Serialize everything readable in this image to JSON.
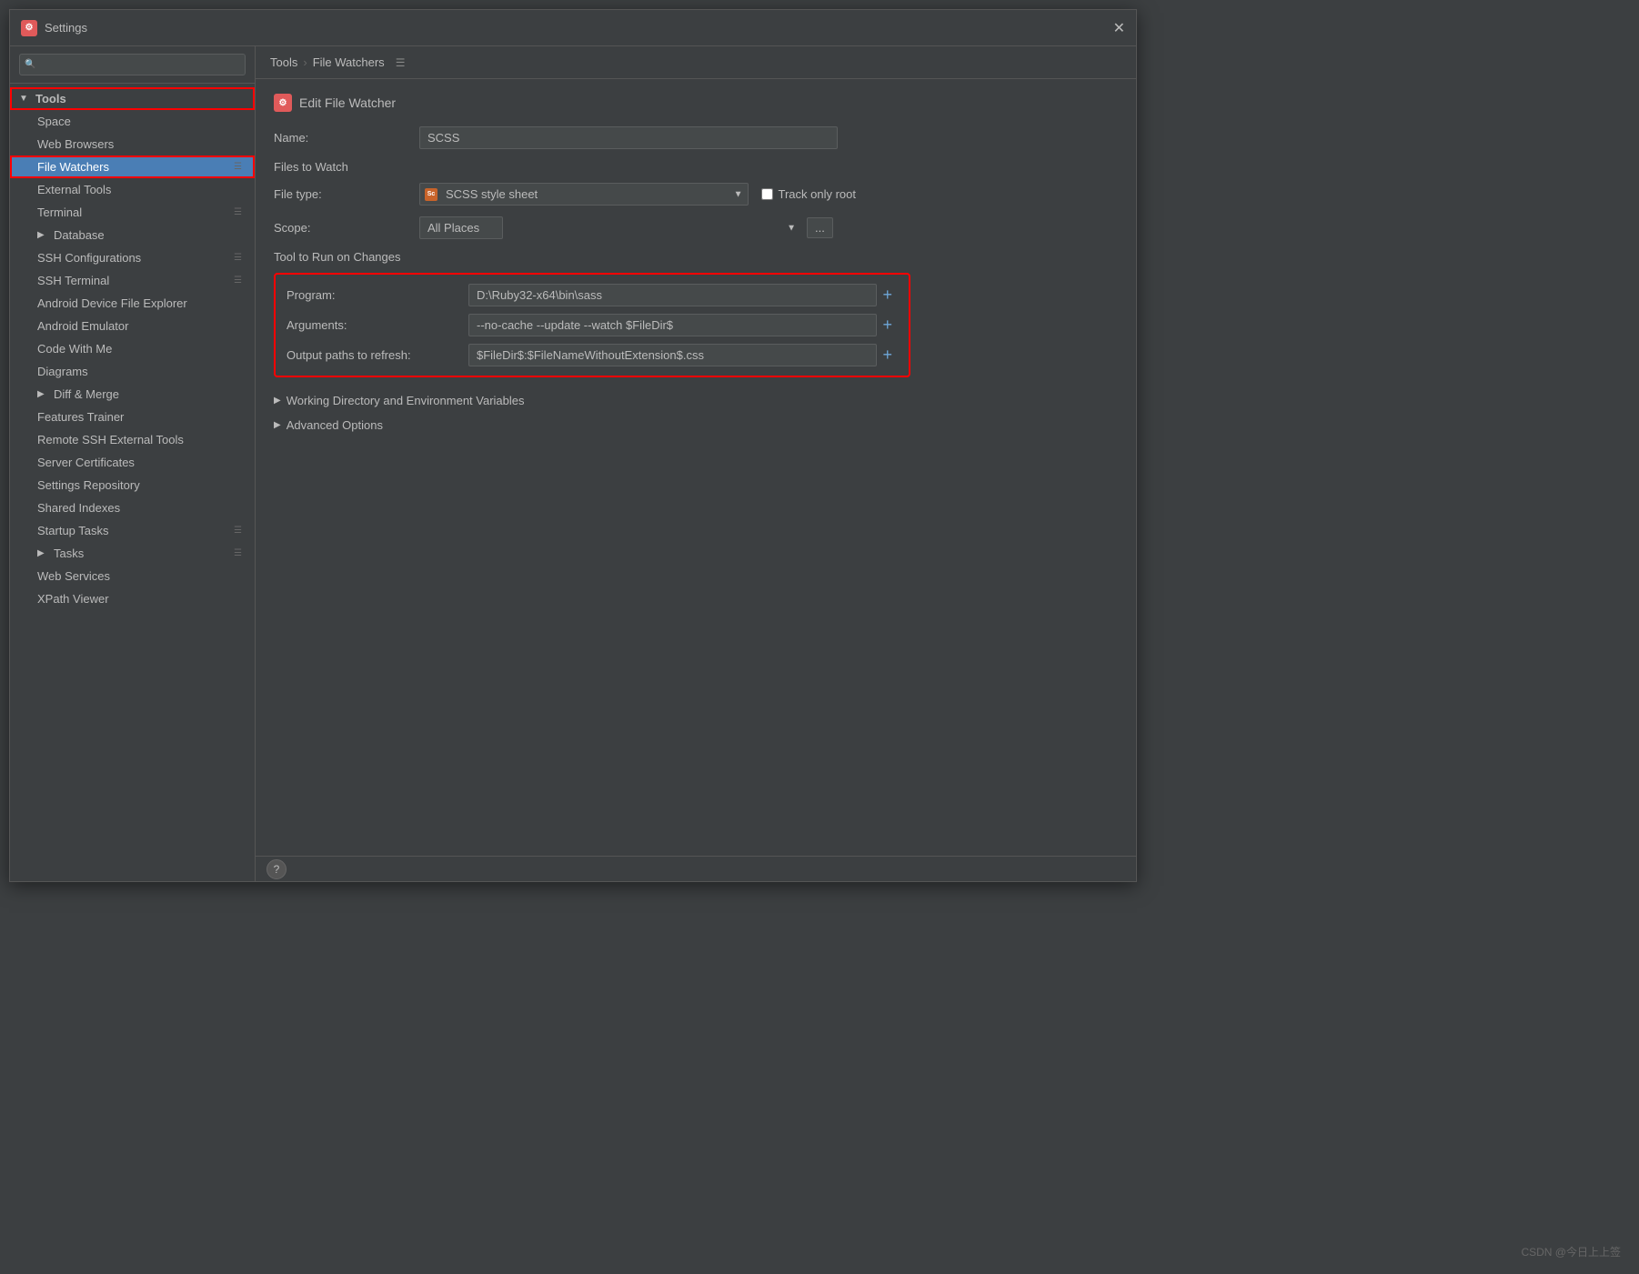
{
  "window": {
    "title": "Settings",
    "close_label": "✕"
  },
  "titlebar": {
    "icon_text": "⚙",
    "title": "Settings"
  },
  "sidebar": {
    "search_placeholder": "🔍",
    "items": [
      {
        "id": "tools",
        "label": "Tools",
        "type": "section-header",
        "expanded": true
      },
      {
        "id": "space",
        "label": "Space",
        "type": "child"
      },
      {
        "id": "web-browsers",
        "label": "Web Browsers",
        "type": "child"
      },
      {
        "id": "file-watchers",
        "label": "File Watchers",
        "type": "child",
        "active": true,
        "has_icon": true
      },
      {
        "id": "external-tools",
        "label": "External Tools",
        "type": "child"
      },
      {
        "id": "terminal",
        "label": "Terminal",
        "type": "child",
        "has_icon": true
      },
      {
        "id": "database",
        "label": "Database",
        "type": "child",
        "has_chevron": true
      },
      {
        "id": "ssh-configurations",
        "label": "SSH Configurations",
        "type": "child",
        "has_icon": true
      },
      {
        "id": "ssh-terminal",
        "label": "SSH Terminal",
        "type": "child",
        "has_icon": true
      },
      {
        "id": "android-device-file-explorer",
        "label": "Android Device File Explorer",
        "type": "child"
      },
      {
        "id": "android-emulator",
        "label": "Android Emulator",
        "type": "child"
      },
      {
        "id": "code-with-me",
        "label": "Code With Me",
        "type": "child"
      },
      {
        "id": "diagrams",
        "label": "Diagrams",
        "type": "child"
      },
      {
        "id": "diff-merge",
        "label": "Diff & Merge",
        "type": "child",
        "has_chevron": true
      },
      {
        "id": "features-trainer",
        "label": "Features Trainer",
        "type": "child"
      },
      {
        "id": "remote-ssh-external-tools",
        "label": "Remote SSH External Tools",
        "type": "child"
      },
      {
        "id": "server-certificates",
        "label": "Server Certificates",
        "type": "child"
      },
      {
        "id": "settings-repository",
        "label": "Settings Repository",
        "type": "child"
      },
      {
        "id": "shared-indexes",
        "label": "Shared Indexes",
        "type": "child"
      },
      {
        "id": "startup-tasks",
        "label": "Startup Tasks",
        "type": "child",
        "has_icon": true
      },
      {
        "id": "tasks",
        "label": "Tasks",
        "type": "child",
        "has_chevron": true,
        "has_icon": true
      },
      {
        "id": "web-services",
        "label": "Web Services",
        "type": "child"
      },
      {
        "id": "xpath-viewer",
        "label": "XPath Viewer",
        "type": "child"
      }
    ]
  },
  "breadcrumb": {
    "tools_label": "Tools",
    "separator": "›",
    "file_watchers_label": "File Watchers",
    "icon": "☰"
  },
  "edit_file_watcher": {
    "header": "Edit File Watcher",
    "icon_text": "⚙"
  },
  "form": {
    "name_label": "Name:",
    "name_value": "SCSS",
    "files_to_watch_title": "Files to Watch",
    "file_type_label": "File type:",
    "file_type_value": "SCSS style sheet",
    "track_only_root_label": "Track only root",
    "scope_label": "Scope:",
    "scope_value": "All Places",
    "tool_to_run_label": "Tool to Run on Changes",
    "program_label": "Program:",
    "program_value": "D:\\Ruby32-x64\\bin\\sass",
    "arguments_label": "Arguments:",
    "arguments_value": "--no-cache --update --watch $FileDir$",
    "output_paths_label": "Output paths to refresh:",
    "output_paths_value": "$FileDir$:$FileNameWithoutExtension$.css",
    "working_dir_label": "Working Directory and Environment Variables",
    "advanced_options_label": "Advanced Options",
    "add_program_btn": "+",
    "add_arguments_btn": "+",
    "add_output_btn": "+"
  },
  "statusbar": {
    "help_label": "?"
  },
  "watermark": {
    "text": "CSDN @今日上上签"
  }
}
